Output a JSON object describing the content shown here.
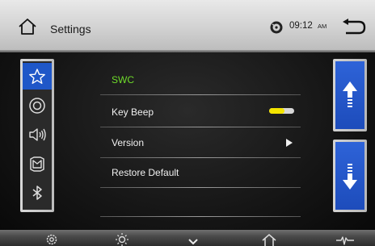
{
  "header": {
    "title": "Settings",
    "clock": {
      "time": "09:12",
      "ampm": "AM"
    },
    "icons": [
      "home-icon",
      "disc-status-icon",
      "back-icon"
    ]
  },
  "left_nav": {
    "items": [
      {
        "id": "favorites",
        "icon": "star-icon",
        "selected": true
      },
      {
        "id": "disc",
        "icon": "disc-icon",
        "selected": false
      },
      {
        "id": "audio",
        "icon": "speaker-icon",
        "selected": false
      },
      {
        "id": "vehicle",
        "icon": "car-icon",
        "selected": false
      },
      {
        "id": "bluetooth",
        "icon": "bluetooth-icon",
        "selected": false
      }
    ]
  },
  "menu": {
    "items": [
      {
        "label": "SWC",
        "highlighted": true
      },
      {
        "label": "Key Beep",
        "control": "toggle"
      },
      {
        "label": "Version",
        "control": "arrow"
      },
      {
        "label": "Restore Default"
      }
    ],
    "key_beep_on": true
  },
  "scroll": {
    "up_icon": "arrow-up-icon",
    "down_icon": "arrow-down-icon"
  },
  "dock": {
    "icons": [
      "gear-icon",
      "brightness-icon",
      "chevron-down-icon",
      "home-outline-icon",
      "equalizer-icon"
    ]
  },
  "colors": {
    "accent_blue": "#1f57c8",
    "highlight_green": "#6fdc2a",
    "toggle_yellow": "#f4e400"
  }
}
